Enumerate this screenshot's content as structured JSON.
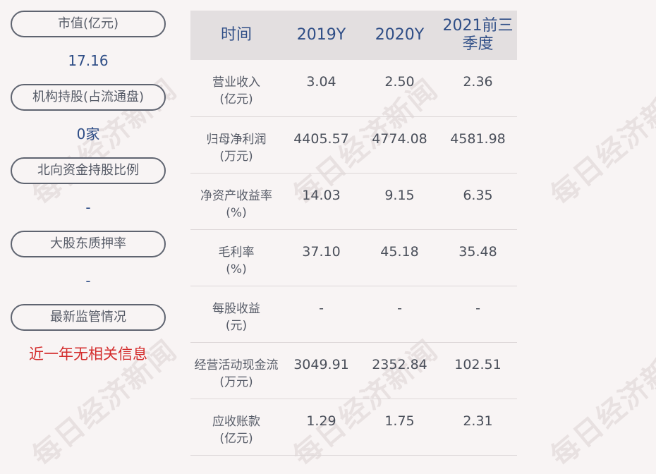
{
  "left_panel": {
    "market_value_label": "市值(亿元)",
    "market_value": "17.16",
    "institution_holding_label": "机构持股(占流通盘)",
    "institution_holding": "0家",
    "northbound_label": "北向资金持股比例",
    "northbound": "-",
    "pledge_label": "大股东质押率",
    "pledge": "-",
    "supervision_label": "最新监管情况",
    "supervision": "近一年无相关信息"
  },
  "table": {
    "headers": [
      "时间",
      "2019Y",
      "2020Y",
      "2021前三季度"
    ],
    "rows": [
      {
        "label": "营业收入\n(亿元)",
        "v2019": "3.04",
        "v2020": "2.50",
        "v2021": "2.36"
      },
      {
        "label": "归母净利润\n(万元)",
        "v2019": "4405.57",
        "v2020": "4774.08",
        "v2021": "4581.98"
      },
      {
        "label": "净资产收益率\n(%)",
        "v2019": "14.03",
        "v2020": "9.15",
        "v2021": "6.35"
      },
      {
        "label": "毛利率\n(%)",
        "v2019": "37.10",
        "v2020": "45.18",
        "v2021": "35.48"
      },
      {
        "label": "每股收益\n(元)",
        "v2019": "-",
        "v2020": "-",
        "v2021": "-"
      },
      {
        "label": "经营活动现金流\n(万元)",
        "v2019": "3049.91",
        "v2020": "2352.84",
        "v2021": "102.51"
      },
      {
        "label": "应收账款\n(亿元)",
        "v2019": "1.29",
        "v2020": "1.75",
        "v2021": "2.31"
      }
    ]
  },
  "watermark": "每日经济新闻",
  "colors": {
    "background": "#f8f4f4",
    "header_bg": "#e3dfe0",
    "accent_blue": "#2e4d86",
    "accent_red": "#d32b2b"
  }
}
